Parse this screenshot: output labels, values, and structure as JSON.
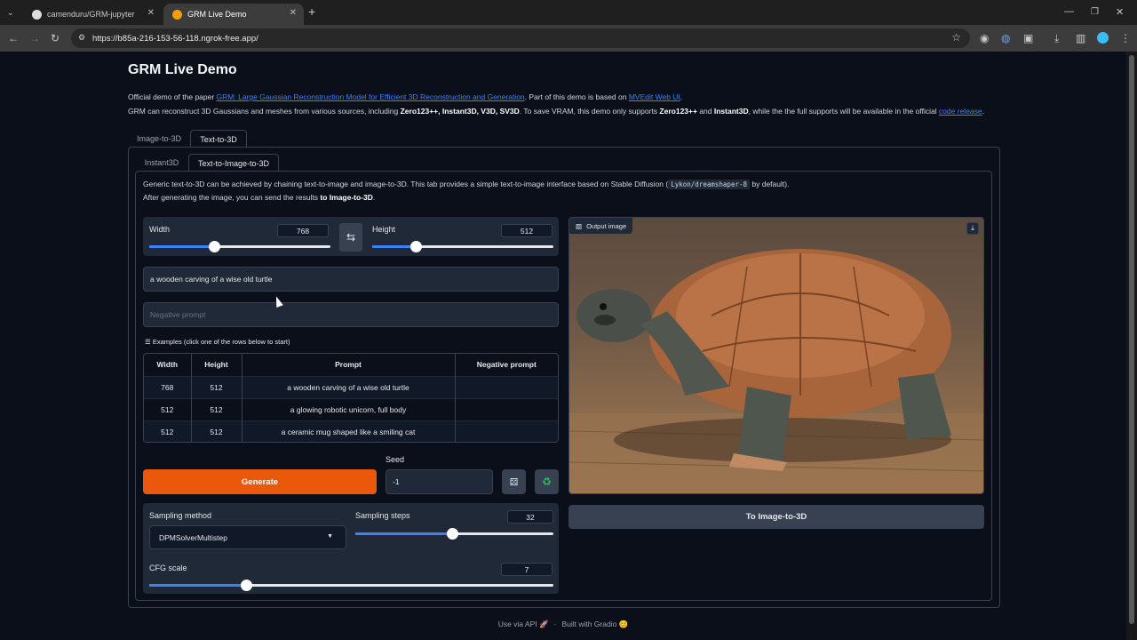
{
  "browser": {
    "tabs": [
      {
        "title": "camenduru/GRM-jupyter",
        "icon": "github-icon"
      },
      {
        "title": "GRM Live Demo",
        "icon": "gradio-icon"
      }
    ],
    "url": "https://b85a-216-153-56-118.ngrok-free.app/"
  },
  "page": {
    "title": "GRM Live Demo",
    "desc1_pre": "Official demo of the paper ",
    "desc1_link1": "GRM: Large Gaussian Reconstruction Model for Efficient 3D Reconstruction and Generation",
    "desc1_mid": ". Part of this demo is based on ",
    "desc1_link2": "MVEdit Web UI",
    "desc1_post": ".",
    "desc2_a": "GRM can reconstruct 3D Gaussians and meshes from various sources, including ",
    "desc2_b": "Zero123++, Instant3D, V3D, SV3D",
    "desc2_c": ". To save VRAM, this demo only supports ",
    "desc2_d": "Zero123++",
    "desc2_e": " and ",
    "desc2_f": "Instant3D",
    "desc2_g": ", while the the full supports will be available in the official ",
    "desc2_link": "code release",
    "desc2_h": "."
  },
  "outer_tabs": [
    "Image-to-3D",
    "Text-to-3D"
  ],
  "inner_tabs": [
    "Instant3D",
    "Text-to-Image-to-3D"
  ],
  "info": {
    "line1_a": "Generic text-to-3D can be achieved by chaining text-to-image and image-to-3D. This tab provides a simple text-to-image interface based on Stable Diffusion (",
    "line1_code": "Lykon/dreamshaper-8",
    "line1_b": " by default).",
    "line2_a": "After generating the image, you can send the results ",
    "line2_b": "to Image-to-3D",
    "line2_c": "."
  },
  "controls": {
    "width_label": "Width",
    "width_value": "768",
    "width_fraction": 0.36,
    "swap_icon": "swap-icon",
    "height_label": "Height",
    "height_value": "512",
    "height_fraction": 0.24,
    "prompt": "a wooden carving of a wise old turtle",
    "negative_placeholder": "Negative prompt",
    "examples_label": "Examples (click one of the rows below to start)",
    "examples_headers": [
      "Width",
      "Height",
      "Prompt",
      "Negative prompt"
    ],
    "examples_rows": [
      [
        "768",
        "512",
        "a wooden carving of a wise old turtle",
        ""
      ],
      [
        "512",
        "512",
        "a glowing robotic unicorn, full body",
        ""
      ],
      [
        "512",
        "512",
        "a ceramic mug shaped like a smiling cat",
        ""
      ]
    ],
    "generate_label": "Generate",
    "seed_label": "Seed",
    "seed_value": "-1",
    "sampling_method_label": "Sampling method",
    "sampling_method_value": "DPMSolverMultistep",
    "sampling_steps_label": "Sampling steps",
    "sampling_steps_value": "32",
    "sampling_steps_fraction": 0.49,
    "cfg_label": "CFG scale",
    "cfg_value": "7",
    "cfg_fraction": 0.24
  },
  "output": {
    "label": "Output image",
    "to_image_label": "To Image-to-3D"
  },
  "footer": {
    "api": "Use via API",
    "built": "Built with Gradio"
  },
  "colors": {
    "accent": "#ea580c",
    "slider": "#3b82f6",
    "background": "#0b0f19"
  }
}
